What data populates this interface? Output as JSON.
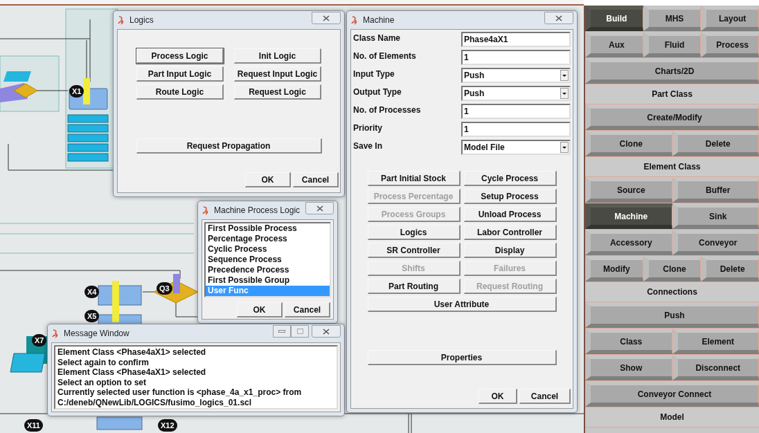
{
  "canvas": {
    "nodes": [
      {
        "label": "X1"
      },
      {
        "label": "X4"
      },
      {
        "label": "X5"
      },
      {
        "label": "X7"
      },
      {
        "label": "Q3"
      },
      {
        "label": "X11"
      },
      {
        "label": "X12"
      }
    ]
  },
  "logics_dialog": {
    "title": "Logics",
    "buttons": [
      {
        "label": "Process Logic",
        "focused": true
      },
      {
        "label": "Init Logic",
        "focused": false
      },
      {
        "label": "Part Input Logic",
        "focused": false
      },
      {
        "label": "Request Input Logic",
        "focused": false
      },
      {
        "label": "Route Logic",
        "focused": false
      },
      {
        "label": "Request Logic",
        "focused": false
      }
    ],
    "wide_button": "Request Propagation",
    "ok": "OK",
    "cancel": "Cancel"
  },
  "process_logic_dialog": {
    "title": "Machine Process Logic",
    "options": [
      {
        "label": "First Possible Process",
        "selected": false
      },
      {
        "label": "Percentage Process",
        "selected": false
      },
      {
        "label": "Cyclic Process",
        "selected": false
      },
      {
        "label": "Sequence Process",
        "selected": false
      },
      {
        "label": "Precedence Process",
        "selected": false
      },
      {
        "label": "First Possible Group",
        "selected": false
      },
      {
        "label": "User Func",
        "selected": true
      }
    ],
    "ok": "OK",
    "cancel": "Cancel"
  },
  "message_window": {
    "title": "Message Window",
    "lines": [
      "Element Class <Phase4aX1> selected",
      "Select again to confirm",
      "Element Class <Phase4aX1> selected",
      "Select an option to set",
      "Currently selected user function is <phase_4a_x1_proc> from",
      "C:/deneb/QNewLib/LOGICS/fusimo_logics_01.scl"
    ]
  },
  "machine_dialog": {
    "title": "Machine",
    "fields": [
      {
        "label": "Class Name",
        "kind": "text",
        "value": "Phase4aX1"
      },
      {
        "label": "No. of Elements",
        "kind": "text",
        "value": "1"
      },
      {
        "label": "Input Type",
        "kind": "select",
        "value": "Push"
      },
      {
        "label": "Output Type",
        "kind": "select",
        "value": "Push"
      },
      {
        "label": "No. of Processes",
        "kind": "text",
        "value": "1"
      },
      {
        "label": "Priority",
        "kind": "text",
        "value": "1"
      },
      {
        "label": "Save In",
        "kind": "select",
        "value": "Model File"
      }
    ],
    "buttons": [
      {
        "label": "Part Initial Stock",
        "disabled": false
      },
      {
        "label": "Cycle Process",
        "disabled": false
      },
      {
        "label": "Process Percentage",
        "disabled": true
      },
      {
        "label": "Setup Process",
        "disabled": false
      },
      {
        "label": "Process Groups",
        "disabled": true
      },
      {
        "label": "Unload Process",
        "disabled": false
      },
      {
        "label": "Logics",
        "disabled": false
      },
      {
        "label": "Labor Controller",
        "disabled": false
      },
      {
        "label": "SR Controller",
        "disabled": false
      },
      {
        "label": "Display",
        "disabled": false
      },
      {
        "label": "Shifts",
        "disabled": true
      },
      {
        "label": "Failures",
        "disabled": true
      },
      {
        "label": "Part Routing",
        "disabled": false
      },
      {
        "label": "Request Routing",
        "disabled": true
      }
    ],
    "wide_button": "User Attribute",
    "properties": "Properties",
    "ok": "OK",
    "cancel": "Cancel"
  },
  "side_panel": {
    "rows": [
      {
        "kind": "buttons",
        "buttons": [
          {
            "label": "Build",
            "selected": true
          },
          {
            "label": "MHS",
            "selected": false
          },
          {
            "label": "Layout",
            "selected": false
          }
        ]
      },
      {
        "kind": "buttons",
        "buttons": [
          {
            "label": "Aux",
            "selected": false
          },
          {
            "label": "Fluid",
            "selected": false
          },
          {
            "label": "Process",
            "selected": false
          }
        ]
      },
      {
        "kind": "buttons",
        "buttons": [
          {
            "label": "Charts/2D",
            "selected": false
          }
        ]
      },
      {
        "kind": "header",
        "label": "Part Class"
      },
      {
        "kind": "buttons",
        "buttons": [
          {
            "label": "Create/Modify",
            "selected": false
          }
        ]
      },
      {
        "kind": "buttons",
        "buttons": [
          {
            "label": "Clone",
            "selected": false
          },
          {
            "label": "Delete",
            "selected": false
          }
        ]
      },
      {
        "kind": "header",
        "label": "Element Class"
      },
      {
        "kind": "buttons",
        "buttons": [
          {
            "label": "Source",
            "selected": false
          },
          {
            "label": "Buffer",
            "selected": false
          }
        ]
      },
      {
        "kind": "buttons",
        "buttons": [
          {
            "label": "Machine",
            "selected": true
          },
          {
            "label": "Sink",
            "selected": false
          }
        ]
      },
      {
        "kind": "buttons",
        "buttons": [
          {
            "label": "Accessory",
            "selected": false
          },
          {
            "label": "Conveyor",
            "selected": false
          }
        ]
      },
      {
        "kind": "buttons",
        "buttons": [
          {
            "label": "Modify",
            "selected": false
          },
          {
            "label": "Clone",
            "selected": false
          },
          {
            "label": "Delete",
            "selected": false
          }
        ]
      },
      {
        "kind": "header",
        "label": "Connections"
      },
      {
        "kind": "buttons",
        "buttons": [
          {
            "label": "Push",
            "selected": false
          }
        ]
      },
      {
        "kind": "buttons",
        "buttons": [
          {
            "label": "Class",
            "selected": false
          },
          {
            "label": "Element",
            "selected": false
          }
        ]
      },
      {
        "kind": "buttons",
        "buttons": [
          {
            "label": "Show",
            "selected": false
          },
          {
            "label": "Disconnect",
            "selected": false
          }
        ]
      },
      {
        "kind": "buttons",
        "buttons": [
          {
            "label": "Conveyor Connect",
            "selected": false
          }
        ]
      },
      {
        "kind": "header",
        "label": "Model"
      }
    ]
  }
}
